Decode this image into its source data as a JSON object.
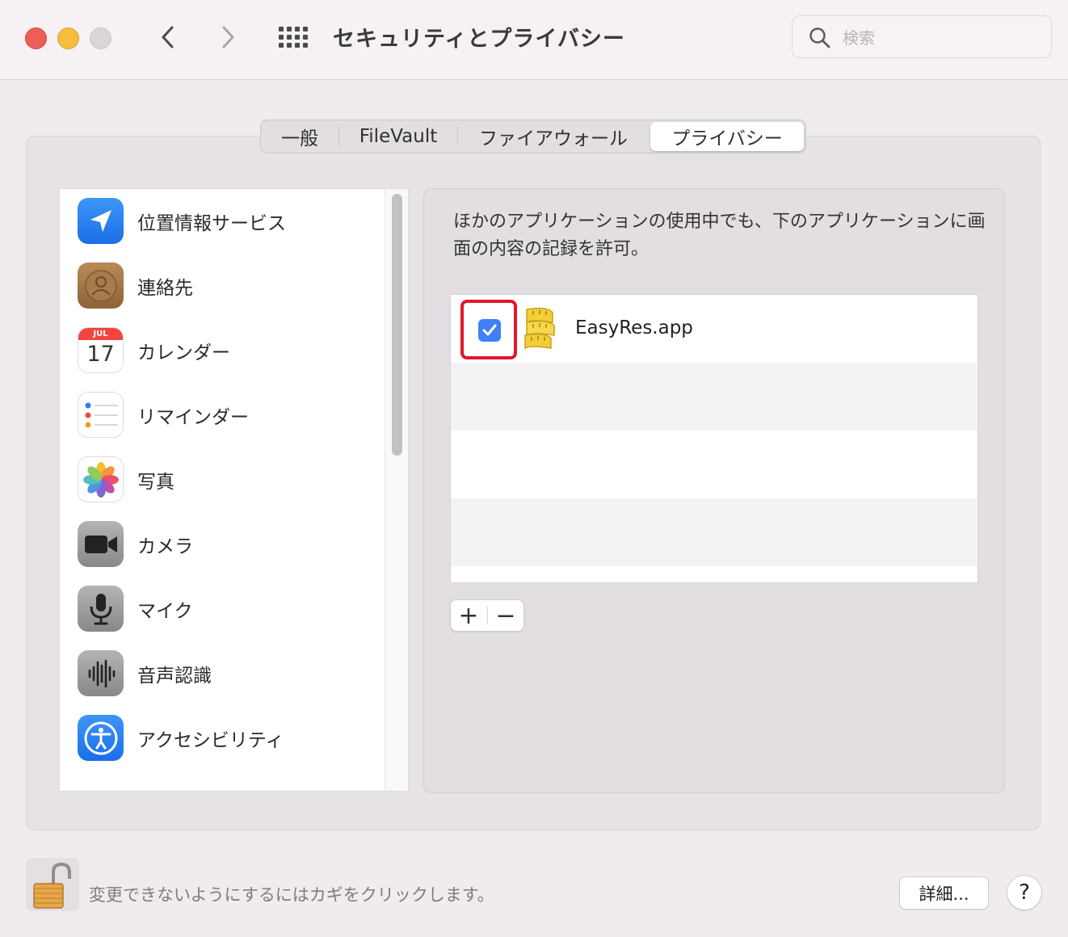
{
  "window": {
    "title": "セキュリティとプライバシー",
    "search_placeholder": "検索"
  },
  "tabs": [
    {
      "label": "一般",
      "active": false
    },
    {
      "label": "FileVault",
      "active": false
    },
    {
      "label": "ファイアウォール",
      "active": false
    },
    {
      "label": "プライバシー",
      "active": true
    }
  ],
  "sidebar": {
    "items": [
      {
        "label": "位置情報サービス",
        "icon": "location-arrow-icon"
      },
      {
        "label": "連絡先",
        "icon": "contacts-icon"
      },
      {
        "label": "カレンダー",
        "icon": "calendar-icon",
        "month": "JUL",
        "day": "17"
      },
      {
        "label": "リマインダー",
        "icon": "reminders-icon"
      },
      {
        "label": "写真",
        "icon": "photos-icon"
      },
      {
        "label": "カメラ",
        "icon": "camera-icon"
      },
      {
        "label": "マイク",
        "icon": "microphone-icon"
      },
      {
        "label": "音声認識",
        "icon": "speech-recognition-icon"
      },
      {
        "label": "アクセシビリティ",
        "icon": "accessibility-icon"
      }
    ]
  },
  "detail": {
    "description": "ほかのアプリケーションの使用中でも、下のアプリケーションに画面の内容の記録を許可。",
    "apps": [
      {
        "name": "EasyRes.app",
        "checked": true,
        "icon": "easyres-tape-measure-icon"
      }
    ],
    "add_label": "+",
    "remove_label": "−"
  },
  "footer": {
    "lock_text": "変更できないようにするにはカギをクリックします。",
    "details_label": "詳細...",
    "help_label": "?"
  },
  "colors": {
    "accent": "#3f80f6",
    "highlight_box": "#e0182a"
  }
}
